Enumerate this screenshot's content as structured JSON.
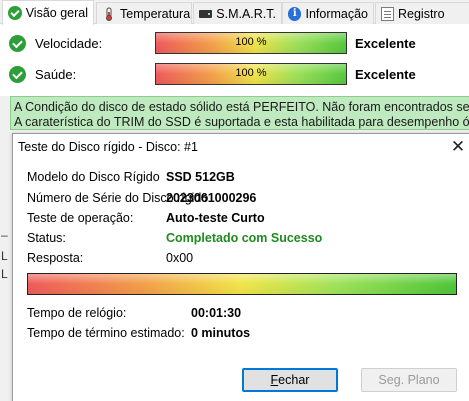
{
  "tabs": [
    {
      "label": "Visão geral",
      "icon": "check-circle-icon",
      "active": true
    },
    {
      "label": "Temperatura",
      "icon": "thermometer-icon",
      "active": false
    },
    {
      "label": "S.M.A.R.T.",
      "icon": "disk-icon",
      "active": false
    },
    {
      "label": "Informação",
      "icon": "info-icon",
      "active": false
    },
    {
      "label": "Registro",
      "icon": "registry-icon",
      "active": false
    }
  ],
  "overview": {
    "metrics": [
      {
        "label": "Velocidade:",
        "bar_text": "100 %",
        "value": "Excelente",
        "level": 100
      },
      {
        "label": "Saúde:",
        "bar_text": "100 %",
        "value": "Excelente",
        "level": 100
      }
    ]
  },
  "status": {
    "line1": "A Condição do disco de estado sólido está PERFEITO. Não foram encontrados setores danificados.",
    "line2": "A caraterística do TRIM do SSD é suportada e esta habilitada para desempenho ótimo."
  },
  "background_marks": [
    "–",
    "L",
    "L"
  ],
  "dialog": {
    "title": "Teste do Disco rígido - Disco: #1",
    "close_glyph": "✕",
    "fields": [
      {
        "label": "Modelo do Disco Rígido",
        "value": "SSD 512GB"
      },
      {
        "label": "Número de Série do Disco rígido",
        "value": "2023061000296"
      },
      {
        "label": "Teste de operação:",
        "value": "Auto-teste Curto"
      },
      {
        "label": "Status:",
        "value": "Completado com Sucesso"
      },
      {
        "label": "Resposta:",
        "value": "0x00"
      }
    ],
    "progress": 100,
    "times": [
      {
        "label": "Tempo de relógio:",
        "value": "00:01:30"
      },
      {
        "label": "Tempo de término estimado:",
        "value": "0 minutos"
      }
    ],
    "buttons": {
      "close_first": "F",
      "close_rest": "echar",
      "background": "Seg. Plano"
    }
  },
  "colors": {
    "status_bg": "#bfe9bf",
    "ok_text": "#1f8a1f",
    "check_green": "#2e9e3a"
  }
}
